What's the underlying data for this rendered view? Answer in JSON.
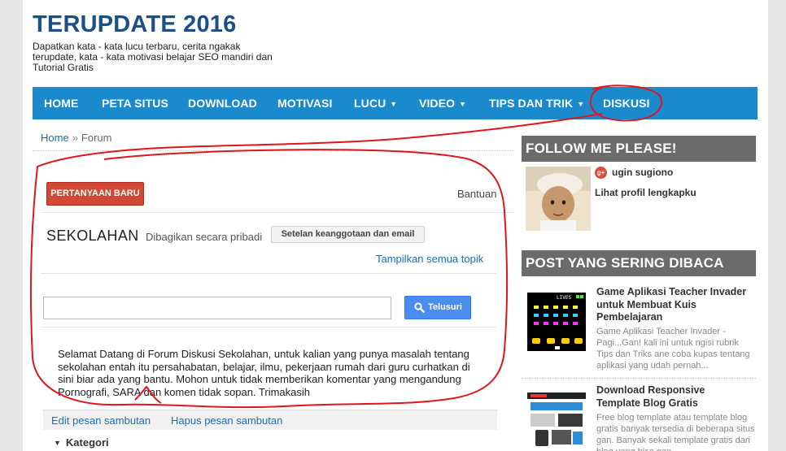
{
  "header": {
    "title": "TERUPDATE 2016",
    "description": "Dapatkan kata - kata lucu terbaru, cerita ngakak terupdate, kata - kata motivasi belajar SEO mandiri dan Tutorial Gratis"
  },
  "nav": {
    "items": [
      {
        "label": "HOME"
      },
      {
        "label": "PETA SITUS"
      },
      {
        "label": "DOWNLOAD"
      },
      {
        "label": "MOTIVASI"
      },
      {
        "label": "LUCU",
        "dropdown": true
      },
      {
        "label": "VIDEO",
        "dropdown": true
      },
      {
        "label": "TIPS DAN TRIK",
        "dropdown": true
      },
      {
        "label": "DISKUSI"
      }
    ],
    "caret": "▼",
    "bg_color": "#1a8acd"
  },
  "breadcrumb": {
    "home": "Home",
    "separator": "»",
    "current": "Forum"
  },
  "forum": {
    "new_question_button": "PERTANYAAN BARU",
    "help": "Bantuan",
    "group_name": "SEKOLAHAN",
    "shared_status": "Dibagikan secara pribadi",
    "settings_button": "Setelan keanggotaan dan email",
    "show_all_topics": "Tampilkan semua topik",
    "search_placeholder": "",
    "search_button": "Telusuri",
    "welcome_message": "Selamat Datang di Forum Diskusi Sekolahan, untuk kalian yang punya masalah tentang sekolahan entah itu persahabatan, belajar, ilmu, pekerjaan rumah dari guru curhatkan di sini biar ada yang bantu. Mohon untuk tidak memberikan komentar yang mengandung Pornografi, SARA dan komen tidak sopan. Trimakasih",
    "edit_welcome": "Edit pesan sambutan",
    "delete_welcome": "Hapus pesan sambutan",
    "category_label": "Kategori",
    "category_toggle": "▼"
  },
  "sidebar": {
    "follow": {
      "title": "FOLLOW ME PLEASE!",
      "gplus_badge": "g+",
      "author_name": "ugin sugiono",
      "profile_link": "Lihat profil lengkapku"
    },
    "popular": {
      "title": "POST YANG SERING DIBACA",
      "posts": [
        {
          "title": "Game Aplikasi Teacher Invader untuk Membuat Kuis Pembelajaran",
          "snippet": "Game Aplikasi Teacher Invader - Pagi...Gan! kali ini untuk ngisi rubrik Tips dan Triks ane coba kupas tentang aplikasi yang udah pernah...",
          "thumb_text": "LIVES"
        },
        {
          "title": "Download Responsive Template Blog Gratis",
          "snippet": "Free blog template atau template blog gratis banyak tersedia di beberapa situs gan. Banyak sekali template gratis dari blog yang bisa gan..."
        }
      ]
    }
  },
  "colors": {
    "title": "#1a4f8a",
    "link": "#1a6fb4",
    "danger_button": "#d14836",
    "search_button": "#4a8cf0",
    "widget_header": "#6b6b6b",
    "annotation": "#e0161c"
  }
}
